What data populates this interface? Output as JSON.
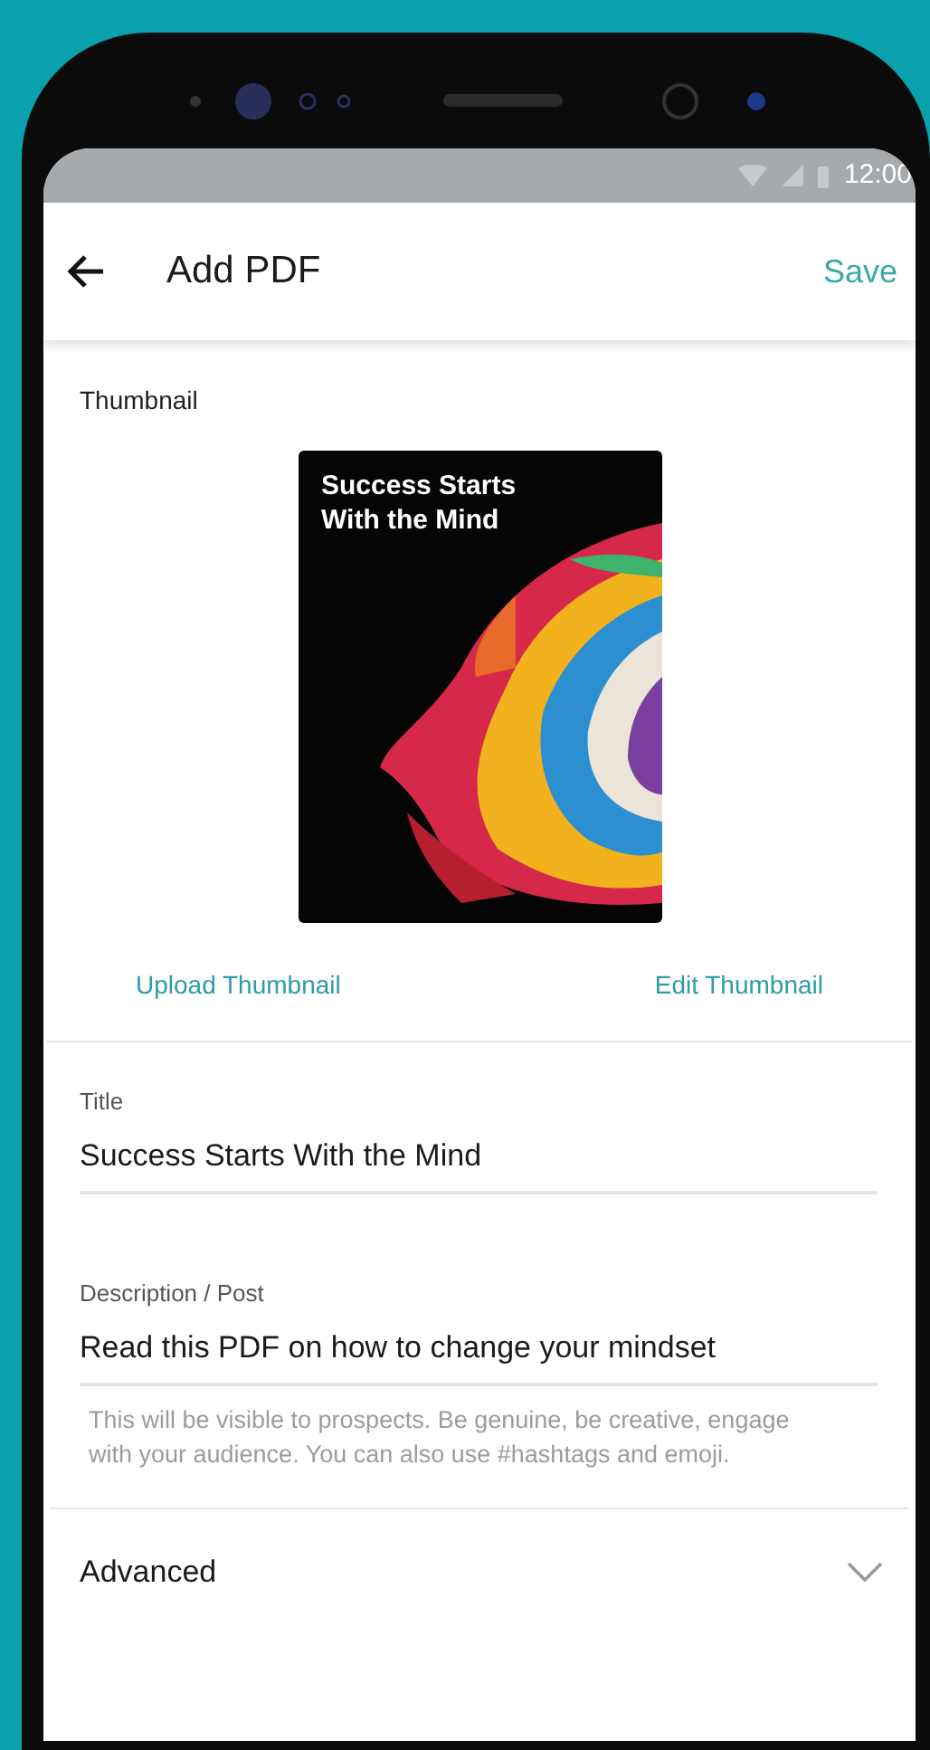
{
  "status_bar": {
    "time": "12:00"
  },
  "app_bar": {
    "title": "Add PDF",
    "action": "Save"
  },
  "thumbnail": {
    "label": "Thumbnail",
    "cover_text": "Success Starts With the Mind",
    "links": [
      "Upload Thumbnail",
      "Edit Thumbnail"
    ]
  },
  "fields": [
    {
      "label": "Title",
      "value": "Success Starts With the Mind"
    },
    {
      "label": "Description / Post",
      "value": "Read this PDF on how to change your mindset",
      "helper": "This will be visible to prospects. Be genuine, be creative, engage with your audience. You can also use #hashtags and emoji."
    }
  ],
  "advanced": {
    "label": "Advanced",
    "expanded": false
  }
}
